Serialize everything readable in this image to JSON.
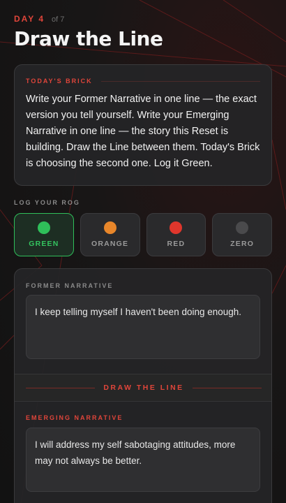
{
  "header": {
    "day_label": "DAY 4",
    "day_of": "of 7",
    "title": "Draw the Line"
  },
  "brick": {
    "label": "TODAY'S BRICK",
    "text": "Write your Former Narrative in one line — the exact version you tell yourself. Write your Emerging Narrative in one line — the story this Reset is building. Draw the Line between them. Today's Brick is choosing the second one. Log it Green."
  },
  "rog": {
    "label": "LOG YOUR ROG",
    "selected": "green",
    "options": [
      {
        "label": "GREEN",
        "color": "#2fbf5a"
      },
      {
        "label": "ORANGE",
        "color": "#e8862a"
      },
      {
        "label": "RED",
        "color": "#e0362c"
      },
      {
        "label": "ZERO",
        "color": "#4a4a4c"
      }
    ]
  },
  "former": {
    "label": "FORMER NARRATIVE",
    "value": "I keep telling myself I haven't been doing enough."
  },
  "divider": {
    "label": "DRAW THE LINE"
  },
  "emerging": {
    "label": "EMERGING NARRATIVE",
    "value": "I will address my self sabotaging attitudes, more may not always be better."
  },
  "colors": {
    "accent": "#e0453a",
    "green": "#2fbf5a"
  }
}
